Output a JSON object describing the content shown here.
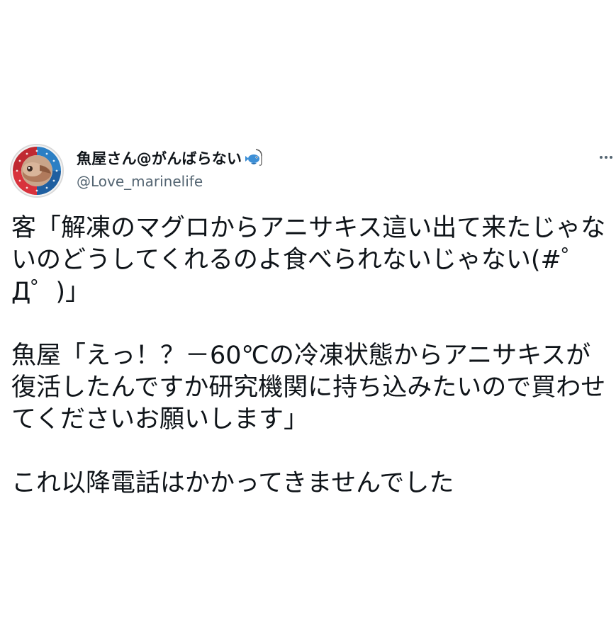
{
  "tweet": {
    "author": {
      "display_name": "魚屋さん@がんばらない",
      "handle": "@Love_marinelife",
      "name_icon": "fishing-fish-icon",
      "avatar_icon": "fish-avatar-icon"
    },
    "more_icon": "more-options-icon",
    "body": {
      "paragraph_1": "客「解凍のマグロからアニサキス這い出て来たじゃないのどうしてくれるのよ食べられないじゃない(#゜Д゜)」",
      "paragraph_2": "魚屋「えっ！？－60℃の冷凍状態からアニサキスが復活したんですか研究機関に持ち込みたいので買わせてくださいお願いします」",
      "paragraph_3": "これ以降電話はかかってきませんでした"
    }
  },
  "colors": {
    "text_primary": "#0f1419",
    "text_secondary": "#536471",
    "background": "#ffffff",
    "avatar_ring_red": "#d8323c",
    "avatar_ring_blue": "#2b7fc4"
  }
}
